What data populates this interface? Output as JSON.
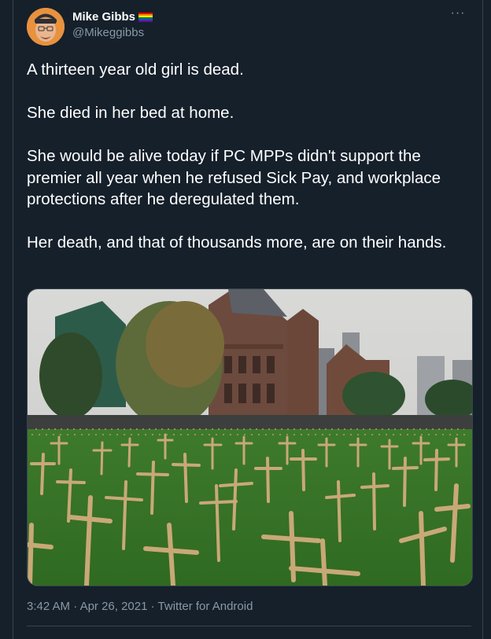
{
  "author": {
    "display_name": "Mike Gibbs",
    "handle": "@Mikeggibbs"
  },
  "more_icon": "ellipsis-icon",
  "tweet": {
    "paragraphs": [
      "A thirteen year old girl is dead.",
      "She died in her bed at home.",
      "She would be alive today if PC MPPs didn't support the premier all year when he refused Sick Pay, and workplace protections after he deregulated them.",
      "Her death, and that of thousands more, are on their hands."
    ]
  },
  "meta": {
    "time": "3:42 AM",
    "date": "Apr 26, 2021",
    "source": "Twitter for Android"
  },
  "colors": {
    "background": "#15202b",
    "text": "#ffffff",
    "secondary": "#8899a6",
    "border": "#38444d"
  }
}
